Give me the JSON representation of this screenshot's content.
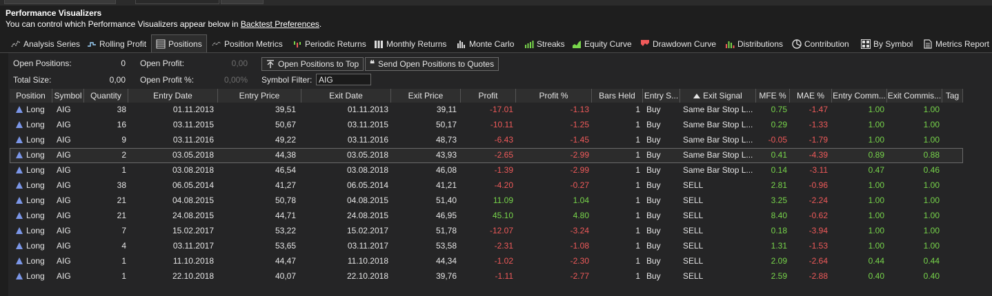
{
  "header": {
    "title": "Performance Visualizers",
    "subtitle_prefix": "You can control which Performance Visualizers appear below in ",
    "subtitle_link": "Backtest Preferences",
    "subtitle_suffix": "."
  },
  "tabs": [
    {
      "label": "Analysis Series",
      "icon": "analysis-series-icon"
    },
    {
      "label": "Rolling Profit",
      "icon": "rolling-profit-icon"
    },
    {
      "label": "Positions",
      "icon": "positions-icon",
      "active": true
    },
    {
      "label": "Position Metrics",
      "icon": "position-metrics-icon"
    },
    {
      "label": "Periodic Returns",
      "icon": "periodic-returns-icon"
    },
    {
      "label": "Monthly Returns",
      "icon": "monthly-returns-icon"
    },
    {
      "label": "Monte Carlo",
      "icon": "monte-carlo-icon"
    },
    {
      "label": "Streaks",
      "icon": "streaks-icon"
    },
    {
      "label": "Equity Curve",
      "icon": "equity-curve-icon"
    },
    {
      "label": "Drawdown Curve",
      "icon": "drawdown-curve-icon"
    },
    {
      "label": "Distributions",
      "icon": "distributions-icon"
    },
    {
      "label": "Contribution",
      "icon": "contribution-icon"
    },
    {
      "label": "By Symbol",
      "icon": "by-symbol-icon"
    },
    {
      "label": "Metrics Report",
      "icon": "metrics-report-icon"
    }
  ],
  "summary": {
    "open_positions_label": "Open Positions:",
    "open_positions_value": "0",
    "total_size_label": "Total Size:",
    "total_size_value": "0,00",
    "open_profit_label": "Open Profit:",
    "open_profit_value": "0,00",
    "open_profit_pct_label": "Open Profit %:",
    "open_profit_pct_value": "0,00%",
    "symbol_filter_label": "Symbol Filter:",
    "symbol_filter_value": "AIG"
  },
  "buttons": {
    "open_to_top": "Open Positions to Top",
    "send_to_quotes": "Send Open Positions to Quotes"
  },
  "columns": [
    "Position",
    "Symbol",
    "Quantity",
    "Entry Date",
    "Entry Price",
    "Exit Date",
    "Exit Price",
    "Profit",
    "Profit %",
    "Bars Held",
    "Entry S...",
    "Exit Signal",
    "MFE %",
    "MAE %",
    "Entry Comm...",
    "Exit Commis...",
    "Tag"
  ],
  "sorted_column": "Exit Signal",
  "rows": [
    {
      "position": "Long",
      "symbol": "AIG",
      "quantity": "38",
      "entry_date": "01.11.2013",
      "entry_price": "39,51",
      "exit_date": "01.11.2013",
      "exit_price": "39,11",
      "profit": "-17.01",
      "profit_pct": "-1.13",
      "bars_held": "1",
      "entry_signal": "Buy",
      "exit_signal": "Same Bar Stop L...",
      "mfe": "0.75",
      "mae": "-1.47",
      "entry_comm": "1.00",
      "exit_comm": "1.00",
      "tag": ""
    },
    {
      "position": "Long",
      "symbol": "AIG",
      "quantity": "16",
      "entry_date": "03.11.2015",
      "entry_price": "50,67",
      "exit_date": "03.11.2015",
      "exit_price": "50,17",
      "profit": "-10.11",
      "profit_pct": "-1.25",
      "bars_held": "1",
      "entry_signal": "Buy",
      "exit_signal": "Same Bar Stop L...",
      "mfe": "0.29",
      "mae": "-1.33",
      "entry_comm": "1.00",
      "exit_comm": "1.00",
      "tag": ""
    },
    {
      "position": "Long",
      "symbol": "AIG",
      "quantity": "9",
      "entry_date": "03.11.2016",
      "entry_price": "49,22",
      "exit_date": "03.11.2016",
      "exit_price": "48,73",
      "profit": "-6.43",
      "profit_pct": "-1.45",
      "bars_held": "1",
      "entry_signal": "Buy",
      "exit_signal": "Same Bar Stop L...",
      "mfe": "-0.05",
      "mae": "-1.79",
      "entry_comm": "1.00",
      "exit_comm": "1.00",
      "tag": ""
    },
    {
      "position": "Long",
      "symbol": "AIG",
      "quantity": "2",
      "entry_date": "03.05.2018",
      "entry_price": "44,38",
      "exit_date": "03.05.2018",
      "exit_price": "43,93",
      "profit": "-2.65",
      "profit_pct": "-2.99",
      "bars_held": "1",
      "entry_signal": "Buy",
      "exit_signal": "Same Bar Stop L...",
      "mfe": "0.41",
      "mae": "-4.39",
      "entry_comm": "0.89",
      "exit_comm": "0.88",
      "tag": "",
      "selected": true
    },
    {
      "position": "Long",
      "symbol": "AIG",
      "quantity": "1",
      "entry_date": "03.08.2018",
      "entry_price": "46,54",
      "exit_date": "03.08.2018",
      "exit_price": "46,08",
      "profit": "-1.39",
      "profit_pct": "-2.99",
      "bars_held": "1",
      "entry_signal": "Buy",
      "exit_signal": "Same Bar Stop L...",
      "mfe": "0.14",
      "mae": "-3.11",
      "entry_comm": "0.47",
      "exit_comm": "0.46",
      "tag": ""
    },
    {
      "position": "Long",
      "symbol": "AIG",
      "quantity": "38",
      "entry_date": "06.05.2014",
      "entry_price": "41,27",
      "exit_date": "06.05.2014",
      "exit_price": "41,21",
      "profit": "-4.20",
      "profit_pct": "-0.27",
      "bars_held": "1",
      "entry_signal": "Buy",
      "exit_signal": "SELL",
      "mfe": "2.81",
      "mae": "-0.96",
      "entry_comm": "1.00",
      "exit_comm": "1.00",
      "tag": ""
    },
    {
      "position": "Long",
      "symbol": "AIG",
      "quantity": "21",
      "entry_date": "04.08.2015",
      "entry_price": "50,78",
      "exit_date": "04.08.2015",
      "exit_price": "51,40",
      "profit": "11.09",
      "profit_pct": "1.04",
      "bars_held": "1",
      "entry_signal": "Buy",
      "exit_signal": "SELL",
      "mfe": "3.25",
      "mae": "-2.24",
      "entry_comm": "1.00",
      "exit_comm": "1.00",
      "tag": ""
    },
    {
      "position": "Long",
      "symbol": "AIG",
      "quantity": "21",
      "entry_date": "24.08.2015",
      "entry_price": "44,71",
      "exit_date": "24.08.2015",
      "exit_price": "46,95",
      "profit": "45.10",
      "profit_pct": "4.80",
      "bars_held": "1",
      "entry_signal": "Buy",
      "exit_signal": "SELL",
      "mfe": "8.40",
      "mae": "-0.62",
      "entry_comm": "1.00",
      "exit_comm": "1.00",
      "tag": ""
    },
    {
      "position": "Long",
      "symbol": "AIG",
      "quantity": "7",
      "entry_date": "15.02.2017",
      "entry_price": "53,22",
      "exit_date": "15.02.2017",
      "exit_price": "51,78",
      "profit": "-12.07",
      "profit_pct": "-3.24",
      "bars_held": "1",
      "entry_signal": "Buy",
      "exit_signal": "SELL",
      "mfe": "0.18",
      "mae": "-3.94",
      "entry_comm": "1.00",
      "exit_comm": "1.00",
      "tag": ""
    },
    {
      "position": "Long",
      "symbol": "AIG",
      "quantity": "4",
      "entry_date": "03.11.2017",
      "entry_price": "53,65",
      "exit_date": "03.11.2017",
      "exit_price": "53,58",
      "profit": "-2.31",
      "profit_pct": "-1.08",
      "bars_held": "1",
      "entry_signal": "Buy",
      "exit_signal": "SELL",
      "mfe": "1.31",
      "mae": "-1.53",
      "entry_comm": "1.00",
      "exit_comm": "1.00",
      "tag": ""
    },
    {
      "position": "Long",
      "symbol": "AIG",
      "quantity": "1",
      "entry_date": "11.10.2018",
      "entry_price": "44,47",
      "exit_date": "11.10.2018",
      "exit_price": "44,34",
      "profit": "-1.02",
      "profit_pct": "-2.30",
      "bars_held": "1",
      "entry_signal": "Buy",
      "exit_signal": "SELL",
      "mfe": "2.09",
      "mae": "-2.64",
      "entry_comm": "0.44",
      "exit_comm": "0.44",
      "tag": ""
    },
    {
      "position": "Long",
      "symbol": "AIG",
      "quantity": "1",
      "entry_date": "22.10.2018",
      "entry_price": "40,07",
      "exit_date": "22.10.2018",
      "exit_price": "39,76",
      "profit": "-1.11",
      "profit_pct": "-2.77",
      "bars_held": "1",
      "entry_signal": "Buy",
      "exit_signal": "SELL",
      "mfe": "2.59",
      "mae": "-2.88",
      "entry_comm": "0.40",
      "exit_comm": "0.40",
      "tag": ""
    }
  ],
  "colors": {
    "background": "#1e1e1e",
    "negative": "#f05a5a",
    "positive": "#78d64b",
    "long_marker": "#7b96e8"
  }
}
